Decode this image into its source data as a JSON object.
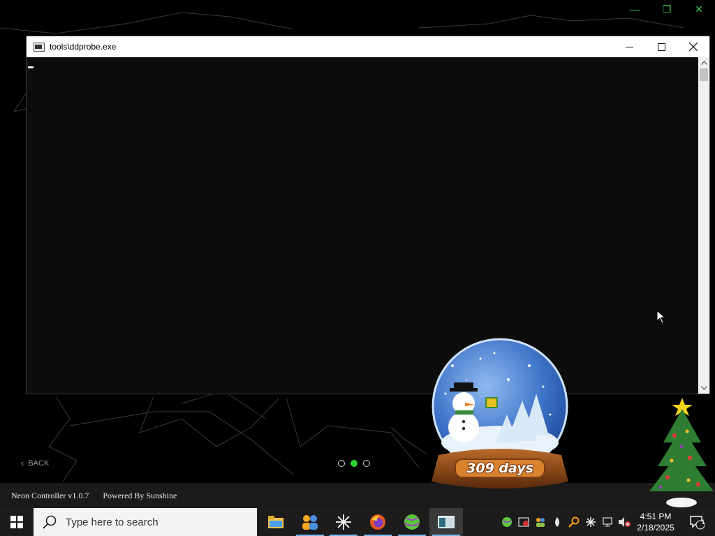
{
  "background_app": {
    "title": "",
    "back_label": "BACK",
    "page_dots": [
      {
        "active": false
      },
      {
        "active": true
      },
      {
        "active": false
      }
    ],
    "footer": {
      "version": "Neon Controller v1.0.7",
      "powered_by": "Powered By Sunshine"
    },
    "accent_color": "#2fd12f"
  },
  "console": {
    "title": "tools\\ddprobe.exe",
    "minimize_label": "—",
    "maximize_label": "☐",
    "close_label": "✕",
    "scroll_up": "▲",
    "scroll_down": "▼"
  },
  "snow_globe": {
    "days_text": "309 days"
  },
  "taskbar": {
    "search_placeholder": "Type here to search",
    "pinned_apps": [
      {
        "name": "file-explorer",
        "running": false,
        "active": false
      },
      {
        "name": "people-app",
        "running": true,
        "active": false
      },
      {
        "name": "snowflake-app",
        "running": true,
        "active": false
      },
      {
        "name": "firefox",
        "running": true,
        "active": false
      },
      {
        "name": "green-ball-app",
        "running": true,
        "active": false
      },
      {
        "name": "console-app",
        "running": true,
        "active": true
      }
    ],
    "tray_icons": [
      "green-ball-icon",
      "security-icon",
      "people-sync-icon",
      "droplet-icon",
      "search-magnifier-icon",
      "snowflake-icon",
      "network-icon",
      "volume-muted-icon"
    ],
    "clock": {
      "time": "4:51 PM",
      "date": "2/18/2025"
    },
    "notification_count": "1"
  }
}
